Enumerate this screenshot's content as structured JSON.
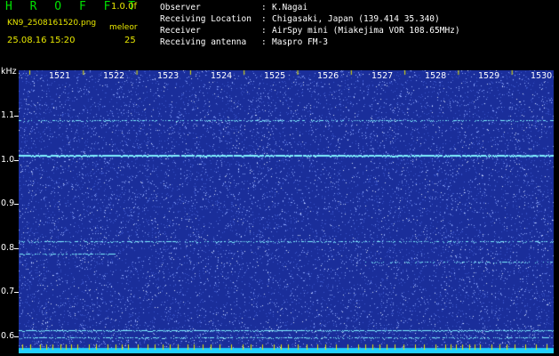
{
  "header": {
    "app_title": "H R O F F T",
    "version": "1.0.0f",
    "file_name": "KN9_2508161520.png",
    "datetime": "25.08.16 15:20",
    "mode_label": "meleor",
    "mode_value": "25",
    "info": [
      {
        "key": "Observer",
        "value": "K.Nagai"
      },
      {
        "key": "Receiving Location",
        "value": "Chigasaki, Japan (139.414 35.340)"
      },
      {
        "key": "Receiver",
        "value": "AirSpy mini (Miakejima VOR 108.65MHz)"
      },
      {
        "key": "Receiving antenna",
        "value": "Maspro FM-3"
      }
    ]
  },
  "spectrogram": {
    "y_unit": "kHz",
    "y_ticks": [
      "1.1",
      "1.0",
      "0.9",
      "0.8",
      "0.7",
      "0.6"
    ],
    "x_ticks": [
      "1521",
      "1522",
      "1523",
      "1524",
      "1525",
      "1526",
      "1527",
      "1528",
      "1529",
      "1530"
    ],
    "colors": {
      "background": "#1a2e9a",
      "noise": "#8fa8ff",
      "signal": "#7ff0ff",
      "baseline": "#20d0ff",
      "tick_marks": "#e8e800"
    }
  }
}
